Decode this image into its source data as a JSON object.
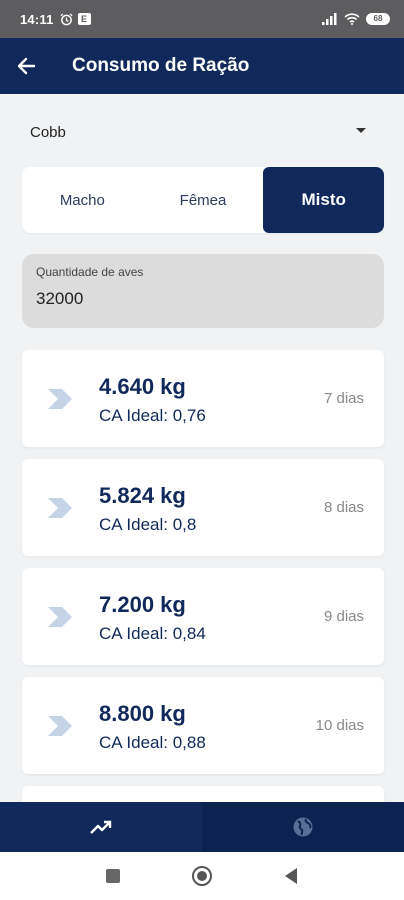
{
  "status_bar": {
    "time": "14:11",
    "left_icons": [
      "alarm-icon",
      "notification-badge-icon"
    ],
    "badge_letter": "E",
    "right_icons": [
      "signal-icon",
      "wifi-icon",
      "battery-icon"
    ],
    "battery": "68"
  },
  "app_bar": {
    "title": "Consumo de Ração",
    "back_icon": "back-arrow-icon",
    "color": "#10295a"
  },
  "lineage_select": {
    "selected": "Cobb"
  },
  "sex_segment": {
    "options": [
      "Macho",
      "Fêmea",
      "Misto"
    ],
    "selected": "Misto"
  },
  "bird_quantity": {
    "label": "Quantidade de aves",
    "value": "32000"
  },
  "consumption_list": [
    {
      "amount": "4.640 kg",
      "ca": "CA Ideal: 0,76",
      "days": "7 dias"
    },
    {
      "amount": "5.824 kg",
      "ca": "CA Ideal: 0,8",
      "days": "8 dias"
    },
    {
      "amount": "7.200 kg",
      "ca": "CA Ideal: 0,84",
      "days": "9 dias"
    },
    {
      "amount": "8.800 kg",
      "ca": "CA Ideal: 0,88",
      "days": "10 dias"
    }
  ],
  "bottom_nav": {
    "items": [
      {
        "icon": "trending-up-icon",
        "active": true
      },
      {
        "icon": "globe-icon",
        "active": false
      }
    ]
  },
  "system_nav": [
    "recents-icon",
    "home-icon",
    "back-icon"
  ]
}
